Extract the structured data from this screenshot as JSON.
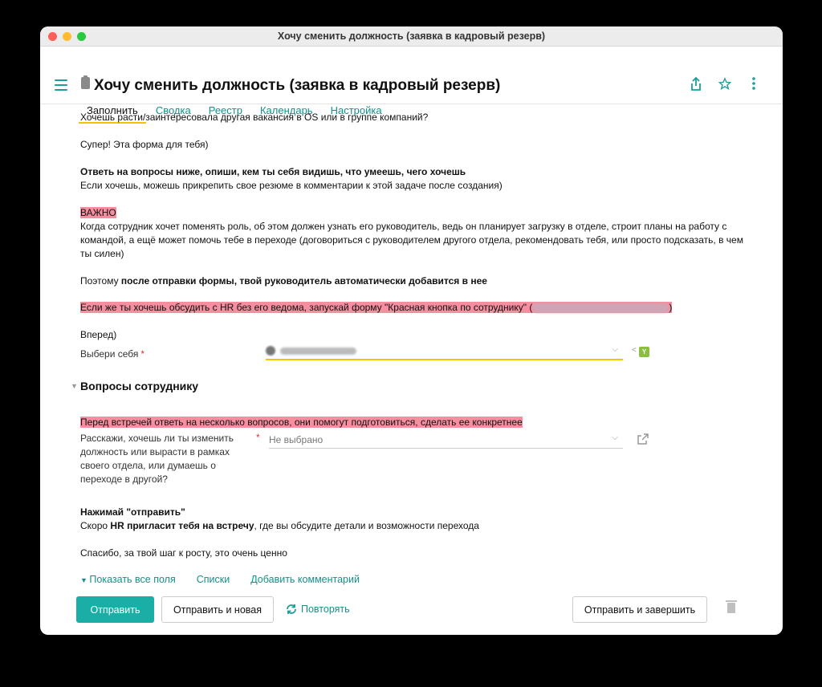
{
  "window": {
    "title": "Хочу сменить должность (заявка в кадровый резерв)"
  },
  "header": {
    "title": "Хочу сменить должность (заявка в кадровый резерв)"
  },
  "tabs": [
    {
      "label": "Заполнить",
      "active": true
    },
    {
      "label": "Сводка"
    },
    {
      "label": "Реестр"
    },
    {
      "label": "Календарь"
    },
    {
      "label": "Настройка"
    }
  ],
  "body": {
    "p1": "Хочешь расти/заинтересовала другая вакансия в OS или в группе компаний?",
    "p2": "Супер! Эта форма для тебя)",
    "p3_bold": "Ответь на вопросы ниже, опиши, кем ты себя видишь, что умеешь, чего хочешь",
    "p3_normal": "Если хочешь, можешь прикрепить свое резюме в комментарии к этой задаче после создания)",
    "important": "ВАЖНО",
    "p4": "Когда сотрудник хочет поменять роль, об этом должен узнать его руководитель, ведь он планирует загрузку в отделе, строит планы на работу с командой, а ещё может помочь тебе в переходе (договориться с руководителем другого отдела, рекомендовать тебя, или просто подсказать, в чем ты силен)",
    "p5_prefix": "Поэтому ",
    "p5_bold": "после отправки формы, твой руководитель  автоматически добавится в нее",
    "p6_start": "Если же ты хочешь обсудить с HR без его ведома, запускай форму \"Красная кнопка по сотруднику\" (",
    "p6_end": ")",
    "p7": "Вперед)"
  },
  "field_self": {
    "label": "Выбери себя",
    "required": "*",
    "badge": "Y",
    "badge_prefix": "<"
  },
  "section": {
    "title": "Вопросы сотруднику"
  },
  "section_body": {
    "hint": "Перед встречей ответь на несколько вопросов, они помогут подготовиться, сделать ее конкретнее",
    "q1_line1": "Расскажи, хочешь ли ты изменить",
    "q1_line2": "должность или вырасти в рамках",
    "q1_line3": "своего отдела, или думаешь о",
    "q1_line4": "переходе в другой?",
    "q1_required": "*",
    "q1_value": "Не выбрано",
    "press_send": "Нажимай \"отправить\"",
    "soon_prefix": "Скоро ",
    "soon_bold": "HR пригласит тебя на встречу",
    "soon_suffix": ", где вы обсудите детали и возможности перехода",
    "thanks": "Спасибо, за твой шаг к росту, это очень ценно"
  },
  "links": {
    "show_all": "Показать все поля",
    "lists": "Списки",
    "add_comment": "Добавить комментарий"
  },
  "buttons": {
    "send": "Отправить",
    "send_new": "Отправить и новая",
    "repeat": "Повторять",
    "send_finish": "Отправить и завершить"
  },
  "colors": {
    "accent": "#1aaea6",
    "highlight": "#f58fa0",
    "tab_underline": "#f5c400"
  }
}
